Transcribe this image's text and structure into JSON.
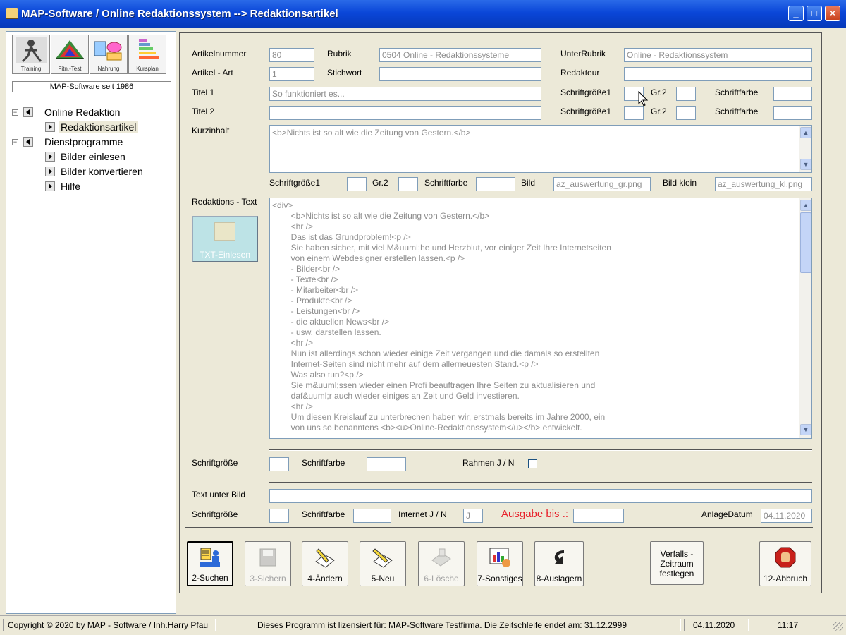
{
  "window": {
    "title": "MAP-Software / Online Redaktionssystem  --> Redaktionsartikel",
    "minimize": "_",
    "maximize": "□",
    "close": "×"
  },
  "left": {
    "tiles": [
      {
        "label": "Training",
        "icon": "training-icon"
      },
      {
        "label": "Fitn.-Test",
        "icon": "fitness-test-icon"
      },
      {
        "label": "Nahrung",
        "icon": "nutrition-icon"
      },
      {
        "label": "Kursplan",
        "icon": "course-plan-icon"
      }
    ],
    "since": "MAP-Software seit 1986",
    "tree": {
      "online_redaktion": "Online Redaktion",
      "redaktionsartikel": "Redaktionsartikel",
      "dienstprogramme": "Dienstprogramme",
      "bilder_einlesen": "Bilder einlesen",
      "bilder_konvertieren": "Bilder konvertieren",
      "hilfe": "Hilfe"
    }
  },
  "form": {
    "artikelnummer_label": "Artikelnummer",
    "artikelnummer": "80",
    "rubrik_label": "Rubrik",
    "rubrik": "0504 Online - Redaktionssysteme",
    "unterrubrik_label": "UnterRubrik",
    "unterrubrik": "Online - Redaktionssystem",
    "artikelart_label": "Artikel - Art",
    "artikelart": "1",
    "stichwort_label": "Stichwort",
    "stichwort": "",
    "redakteur_label": "Redakteur",
    "redakteur": "",
    "titel1_label": "Titel 1",
    "titel1": "So funktioniert es...",
    "titel2_label": "Titel 2",
    "titel2": "",
    "schriftgroesse1_label": "Schriftgröße1",
    "gr2_label": "Gr.2",
    "schriftfarbe_label": "Schriftfarbe",
    "kurzinhalt_label": "Kurzinhalt",
    "kurzinhalt": "<b>Nichts ist so alt wie die Zeitung von Gestern.</b>",
    "bild_label": "Bild",
    "bild": "az_auswertung_gr.png",
    "bild_klein_label": "Bild klein",
    "bild_klein": "az_auswertung_kl.png",
    "redaktionstext_label": "Redaktions - Text",
    "txt_button": "TXT-Einlesen",
    "redaktionstext": "<div>\n        <b>Nichts ist so alt wie die Zeitung von Gestern.</b>\n        <hr />\n        Das ist das Grundproblem!<p />\n        Sie haben sicher, mit viel M&uuml;he und Herzblut, vor einiger Zeit Ihre Internetseiten\n        von einem Webdesigner erstellen lassen.<p />\n        - Bilder<br />\n        - Texte<br />\n        - Mitarbeiter<br />\n        - Produkte<br />\n        - Leistungen<br />\n        - die aktuellen News<br />\n        - usw. darstellen lassen.\n        <hr />\n        Nun ist allerdings schon wieder einige Zeit vergangen und die damals so erstellten\n        Internet-Seiten sind nicht mehr auf dem allerneuesten Stand.<p />\n        Was also tun?<p />\n        Sie m&uuml;ssen wieder einen Profi beauftragen Ihre Seiten zu aktualisieren und\n        daf&uuml;r auch wieder einiges an Zeit und Geld investieren.\n        <hr />\n        Um diesen Kreislauf zu unterbrechen haben wir, erstmals bereits im Jahre 2000, ein\n        von uns so benanntens <b><u>Online-Redaktionssystem</u></b> entwickelt.",
    "schriftgroesse_label": "Schriftgröße",
    "rahmen_label": "Rahmen J / N",
    "text_unter_bild_label": "Text unter Bild",
    "internet_label": "Internet J / N",
    "internet": "J",
    "ausgabe_label": "Ausgabe bis .:",
    "anlagedatum_label": "AnlageDatum",
    "anlagedatum": "04.11.2020"
  },
  "toolbar": {
    "suchen": "2-Suchen",
    "sichern": "3-Sichern",
    "aendern": "4-Ändern",
    "neu": "5-Neu",
    "loesche": "6-Lösche",
    "sonstiges": "7-Sonstiges",
    "auslagern": "8-Auslagern",
    "verfall": "Verfalls -\nZeitraum\nfestlegen",
    "abbruch": "12-Abbruch"
  },
  "status": {
    "copyright": "Copyright © 2020 by MAP - Software / Inh.Harry Pfau",
    "license": "Dieses Programm ist lizensiert für: MAP-Software Testfirma. Die Zeitschleife endet am: 31.12.2999",
    "date": "04.11.2020",
    "time": "11:17"
  },
  "colors": {
    "titlebar": "#0a46d8",
    "accent_red": "#e8202a",
    "field_border": "#7f9db9"
  }
}
